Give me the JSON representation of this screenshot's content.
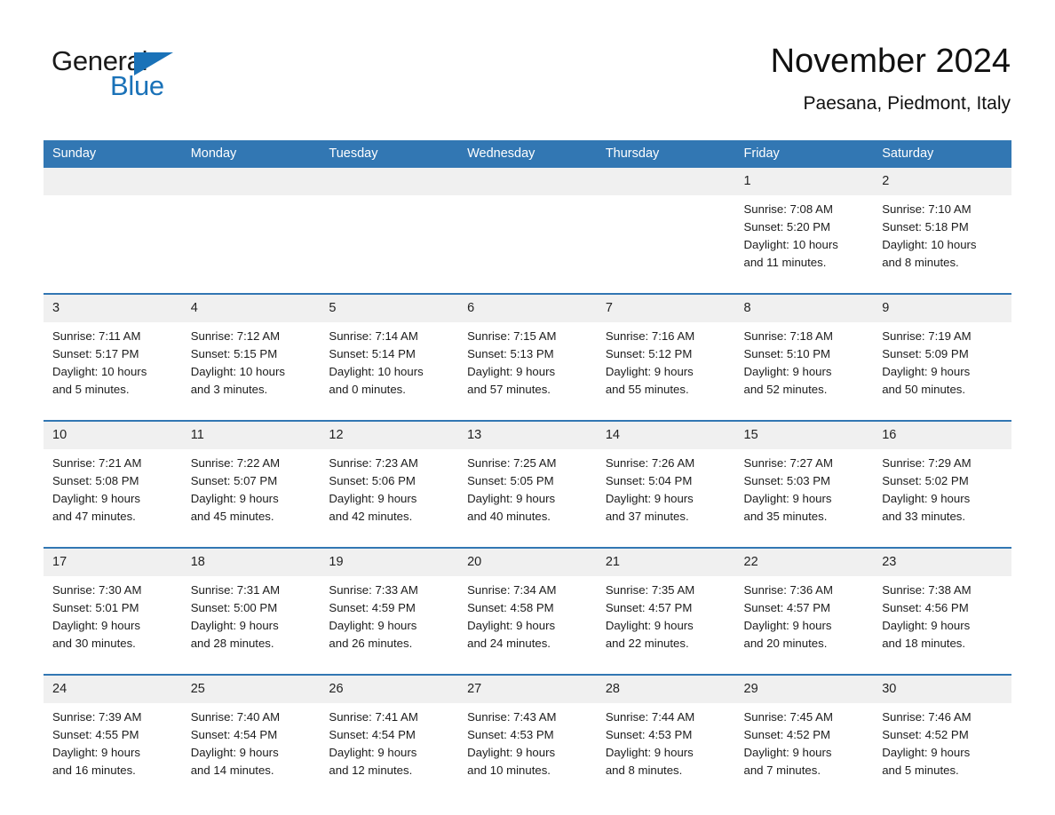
{
  "logo": {
    "word_one": "General",
    "word_two": "Blue",
    "triangle_icon": "triangle-icon",
    "accent_color": "#1a72b8"
  },
  "header": {
    "title": "November 2024",
    "location": "Paesana, Piedmont, Italy"
  },
  "colors": {
    "header_row": "#3277b3",
    "day_number_strip": "#f0f0f0",
    "week_separator": "#3277b3",
    "text": "#1c1c1c",
    "background": "#ffffff"
  },
  "calendar": {
    "weekday_headers": [
      "Sunday",
      "Monday",
      "Tuesday",
      "Wednesday",
      "Thursday",
      "Friday",
      "Saturday"
    ],
    "weeks": [
      [
        {
          "day": "",
          "sunrise": "",
          "sunset": "",
          "daylight_line1": "",
          "daylight_line2": ""
        },
        {
          "day": "",
          "sunrise": "",
          "sunset": "",
          "daylight_line1": "",
          "daylight_line2": ""
        },
        {
          "day": "",
          "sunrise": "",
          "sunset": "",
          "daylight_line1": "",
          "daylight_line2": ""
        },
        {
          "day": "",
          "sunrise": "",
          "sunset": "",
          "daylight_line1": "",
          "daylight_line2": ""
        },
        {
          "day": "",
          "sunrise": "",
          "sunset": "",
          "daylight_line1": "",
          "daylight_line2": ""
        },
        {
          "day": "1",
          "sunrise": "Sunrise: 7:08 AM",
          "sunset": "Sunset: 5:20 PM",
          "daylight_line1": "Daylight: 10 hours",
          "daylight_line2": "and 11 minutes."
        },
        {
          "day": "2",
          "sunrise": "Sunrise: 7:10 AM",
          "sunset": "Sunset: 5:18 PM",
          "daylight_line1": "Daylight: 10 hours",
          "daylight_line2": "and 8 minutes."
        }
      ],
      [
        {
          "day": "3",
          "sunrise": "Sunrise: 7:11 AM",
          "sunset": "Sunset: 5:17 PM",
          "daylight_line1": "Daylight: 10 hours",
          "daylight_line2": "and 5 minutes."
        },
        {
          "day": "4",
          "sunrise": "Sunrise: 7:12 AM",
          "sunset": "Sunset: 5:15 PM",
          "daylight_line1": "Daylight: 10 hours",
          "daylight_line2": "and 3 minutes."
        },
        {
          "day": "5",
          "sunrise": "Sunrise: 7:14 AM",
          "sunset": "Sunset: 5:14 PM",
          "daylight_line1": "Daylight: 10 hours",
          "daylight_line2": "and 0 minutes."
        },
        {
          "day": "6",
          "sunrise": "Sunrise: 7:15 AM",
          "sunset": "Sunset: 5:13 PM",
          "daylight_line1": "Daylight: 9 hours",
          "daylight_line2": "and 57 minutes."
        },
        {
          "day": "7",
          "sunrise": "Sunrise: 7:16 AM",
          "sunset": "Sunset: 5:12 PM",
          "daylight_line1": "Daylight: 9 hours",
          "daylight_line2": "and 55 minutes."
        },
        {
          "day": "8",
          "sunrise": "Sunrise: 7:18 AM",
          "sunset": "Sunset: 5:10 PM",
          "daylight_line1": "Daylight: 9 hours",
          "daylight_line2": "and 52 minutes."
        },
        {
          "day": "9",
          "sunrise": "Sunrise: 7:19 AM",
          "sunset": "Sunset: 5:09 PM",
          "daylight_line1": "Daylight: 9 hours",
          "daylight_line2": "and 50 minutes."
        }
      ],
      [
        {
          "day": "10",
          "sunrise": "Sunrise: 7:21 AM",
          "sunset": "Sunset: 5:08 PM",
          "daylight_line1": "Daylight: 9 hours",
          "daylight_line2": "and 47 minutes."
        },
        {
          "day": "11",
          "sunrise": "Sunrise: 7:22 AM",
          "sunset": "Sunset: 5:07 PM",
          "daylight_line1": "Daylight: 9 hours",
          "daylight_line2": "and 45 minutes."
        },
        {
          "day": "12",
          "sunrise": "Sunrise: 7:23 AM",
          "sunset": "Sunset: 5:06 PM",
          "daylight_line1": "Daylight: 9 hours",
          "daylight_line2": "and 42 minutes."
        },
        {
          "day": "13",
          "sunrise": "Sunrise: 7:25 AM",
          "sunset": "Sunset: 5:05 PM",
          "daylight_line1": "Daylight: 9 hours",
          "daylight_line2": "and 40 minutes."
        },
        {
          "day": "14",
          "sunrise": "Sunrise: 7:26 AM",
          "sunset": "Sunset: 5:04 PM",
          "daylight_line1": "Daylight: 9 hours",
          "daylight_line2": "and 37 minutes."
        },
        {
          "day": "15",
          "sunrise": "Sunrise: 7:27 AM",
          "sunset": "Sunset: 5:03 PM",
          "daylight_line1": "Daylight: 9 hours",
          "daylight_line2": "and 35 minutes."
        },
        {
          "day": "16",
          "sunrise": "Sunrise: 7:29 AM",
          "sunset": "Sunset: 5:02 PM",
          "daylight_line1": "Daylight: 9 hours",
          "daylight_line2": "and 33 minutes."
        }
      ],
      [
        {
          "day": "17",
          "sunrise": "Sunrise: 7:30 AM",
          "sunset": "Sunset: 5:01 PM",
          "daylight_line1": "Daylight: 9 hours",
          "daylight_line2": "and 30 minutes."
        },
        {
          "day": "18",
          "sunrise": "Sunrise: 7:31 AM",
          "sunset": "Sunset: 5:00 PM",
          "daylight_line1": "Daylight: 9 hours",
          "daylight_line2": "and 28 minutes."
        },
        {
          "day": "19",
          "sunrise": "Sunrise: 7:33 AM",
          "sunset": "Sunset: 4:59 PM",
          "daylight_line1": "Daylight: 9 hours",
          "daylight_line2": "and 26 minutes."
        },
        {
          "day": "20",
          "sunrise": "Sunrise: 7:34 AM",
          "sunset": "Sunset: 4:58 PM",
          "daylight_line1": "Daylight: 9 hours",
          "daylight_line2": "and 24 minutes."
        },
        {
          "day": "21",
          "sunrise": "Sunrise: 7:35 AM",
          "sunset": "Sunset: 4:57 PM",
          "daylight_line1": "Daylight: 9 hours",
          "daylight_line2": "and 22 minutes."
        },
        {
          "day": "22",
          "sunrise": "Sunrise: 7:36 AM",
          "sunset": "Sunset: 4:57 PM",
          "daylight_line1": "Daylight: 9 hours",
          "daylight_line2": "and 20 minutes."
        },
        {
          "day": "23",
          "sunrise": "Sunrise: 7:38 AM",
          "sunset": "Sunset: 4:56 PM",
          "daylight_line1": "Daylight: 9 hours",
          "daylight_line2": "and 18 minutes."
        }
      ],
      [
        {
          "day": "24",
          "sunrise": "Sunrise: 7:39 AM",
          "sunset": "Sunset: 4:55 PM",
          "daylight_line1": "Daylight: 9 hours",
          "daylight_line2": "and 16 minutes."
        },
        {
          "day": "25",
          "sunrise": "Sunrise: 7:40 AM",
          "sunset": "Sunset: 4:54 PM",
          "daylight_line1": "Daylight: 9 hours",
          "daylight_line2": "and 14 minutes."
        },
        {
          "day": "26",
          "sunrise": "Sunrise: 7:41 AM",
          "sunset": "Sunset: 4:54 PM",
          "daylight_line1": "Daylight: 9 hours",
          "daylight_line2": "and 12 minutes."
        },
        {
          "day": "27",
          "sunrise": "Sunrise: 7:43 AM",
          "sunset": "Sunset: 4:53 PM",
          "daylight_line1": "Daylight: 9 hours",
          "daylight_line2": "and 10 minutes."
        },
        {
          "day": "28",
          "sunrise": "Sunrise: 7:44 AM",
          "sunset": "Sunset: 4:53 PM",
          "daylight_line1": "Daylight: 9 hours",
          "daylight_line2": "and 8 minutes."
        },
        {
          "day": "29",
          "sunrise": "Sunrise: 7:45 AM",
          "sunset": "Sunset: 4:52 PM",
          "daylight_line1": "Daylight: 9 hours",
          "daylight_line2": "and 7 minutes."
        },
        {
          "day": "30",
          "sunrise": "Sunrise: 7:46 AM",
          "sunset": "Sunset: 4:52 PM",
          "daylight_line1": "Daylight: 9 hours",
          "daylight_line2": "and 5 minutes."
        }
      ]
    ]
  }
}
